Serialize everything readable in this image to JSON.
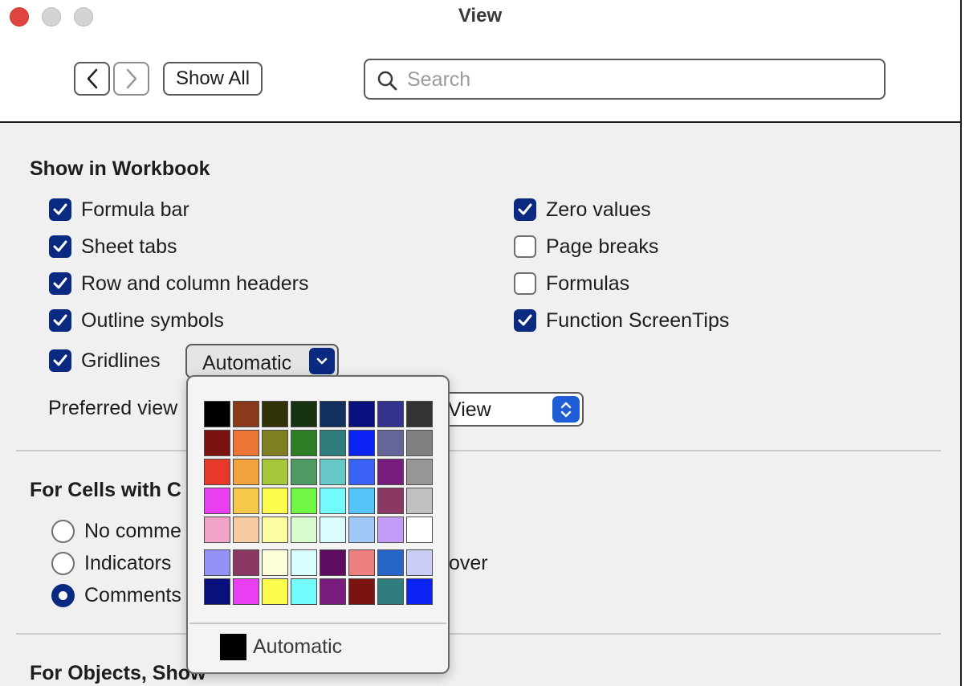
{
  "window": {
    "title": "View"
  },
  "toolbar": {
    "show_all_label": "Show All",
    "search_placeholder": "Search",
    "search_value": ""
  },
  "show_in_workbook": {
    "title": "Show in Workbook",
    "left_options": [
      {
        "label": "Formula bar",
        "checked": true
      },
      {
        "label": "Sheet tabs",
        "checked": true
      },
      {
        "label": "Row and column headers",
        "checked": true
      },
      {
        "label": "Outline symbols",
        "checked": true
      },
      {
        "label": "Gridlines",
        "checked": true
      }
    ],
    "right_options": [
      {
        "label": "Zero values",
        "checked": true
      },
      {
        "label": "Page breaks",
        "checked": false
      },
      {
        "label": "Formulas",
        "checked": false
      },
      {
        "label": "Function ScreenTips",
        "checked": true
      }
    ],
    "gridline_color_selected": "Automatic",
    "preferred_view_label": "Preferred view",
    "preferred_view_value_visible": "View"
  },
  "cells_with_comments": {
    "title_visible": "For Cells with C",
    "options": [
      {
        "label_visible": "No comme",
        "selected": false
      },
      {
        "label_visible": "Indicators",
        "selected": false,
        "trailing_visible": "over"
      },
      {
        "label_visible": "Comments",
        "selected": true
      }
    ]
  },
  "objects_show": {
    "title_visible": "For Objects, Show"
  },
  "gridline_palette": {
    "automatic_label": "Automatic",
    "automatic_color": "#000000",
    "rows": [
      [
        "#000000",
        "#8a3a1a",
        "#33330a",
        "#173311",
        "#12305e",
        "#0a0f7e",
        "#33338f",
        "#333333"
      ],
      [
        "#7b1410",
        "#ec7434",
        "#7f7f22",
        "#2d7d27",
        "#2f7d7d",
        "#0a23f2",
        "#65659a",
        "#808080"
      ],
      [
        "#e8382a",
        "#f2a33d",
        "#a7c73b",
        "#4e9a63",
        "#66c7c7",
        "#3a63f5",
        "#781d7e",
        "#969696"
      ],
      [
        "#ea3ef2",
        "#f7c94a",
        "#fcfc4c",
        "#6ff744",
        "#74fcfc",
        "#55c5f7",
        "#8c3864",
        "#c0c0c0"
      ],
      [
        "#f1a3c9",
        "#f7cca2",
        "#fdfca1",
        "#d9fccf",
        "#dbfcfc",
        "#a1c9f7",
        "#c39cf7",
        "#ffffff"
      ],
      [
        "#9393f7",
        "#8c3864",
        "#fdfdd7",
        "#d9fcfc",
        "#5f0c63",
        "#ee7f7f",
        "#2666c9",
        "#cccdf7"
      ],
      [
        "#0a0f7e",
        "#ea3ef2",
        "#fcfc4c",
        "#74fcfc",
        "#781d7e",
        "#7b1410",
        "#2f7d7d",
        "#0a23f2"
      ]
    ]
  }
}
